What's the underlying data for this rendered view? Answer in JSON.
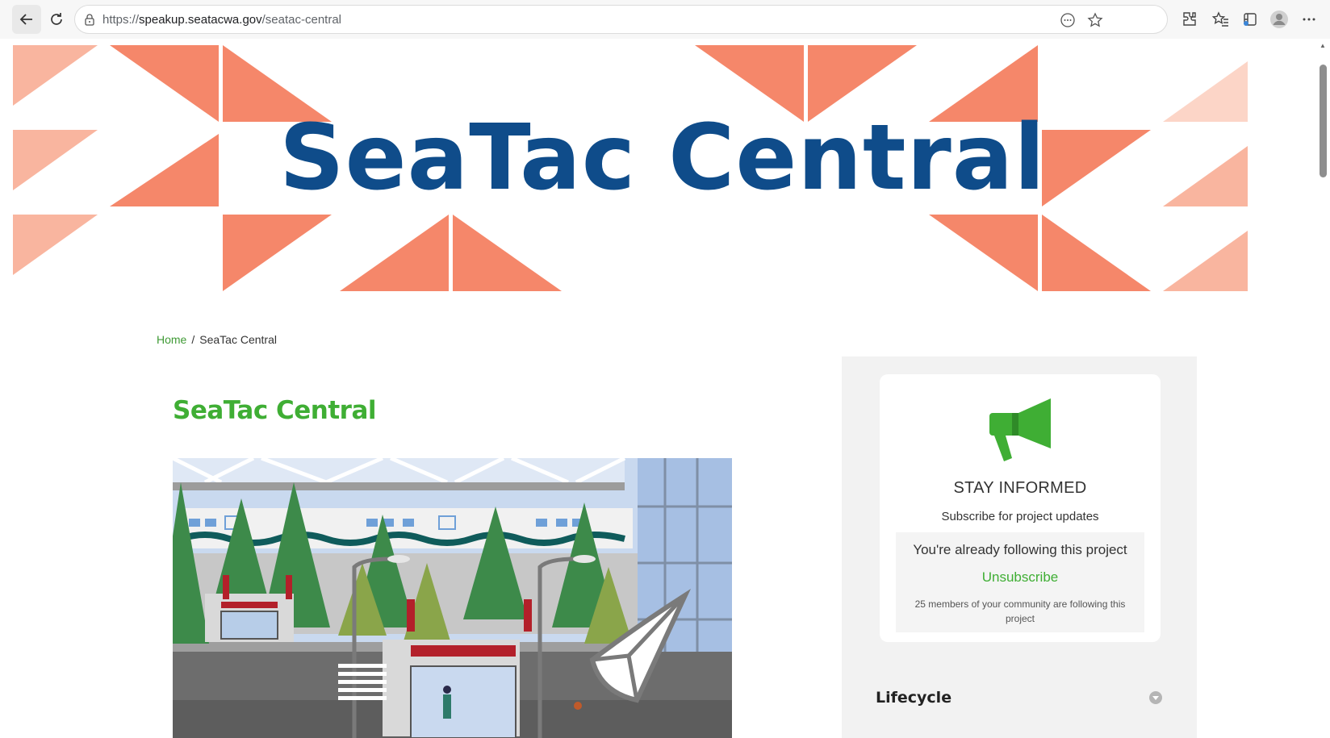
{
  "browser": {
    "url_prefix": "https://",
    "url_host": "speakup.seatacwa.gov",
    "url_path": "/seatac-central"
  },
  "banner": {
    "title": "SeaTac Central",
    "colors": {
      "coral": "#f5876a",
      "light_coral": "#f9b59f",
      "pale_coral": "#fcd5c7",
      "title_blue": "#0f4c8a"
    }
  },
  "breadcrumb": {
    "home": "Home",
    "separator": "/",
    "current": "SeaTac Central"
  },
  "page": {
    "title": "SeaTac Central",
    "accent_green": "#3fae34"
  },
  "sidebar": {
    "stay_informed": "STAY INFORMED",
    "subscribe_text": "Subscribe for project updates",
    "following_text": "You're already following this project",
    "unsubscribe_label": "Unsubscribe",
    "members_text": "25 members of your community are following this project",
    "lifecycle_label": "Lifecycle"
  }
}
